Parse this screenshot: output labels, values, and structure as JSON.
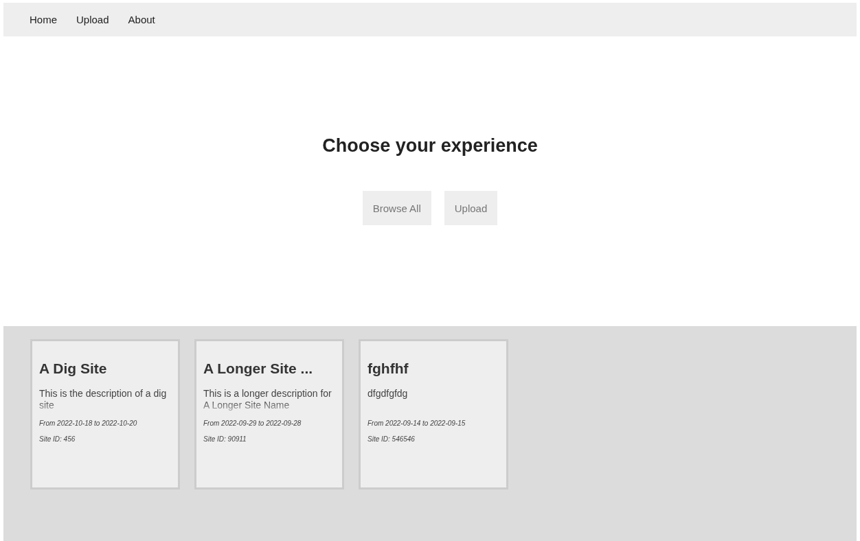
{
  "nav": {
    "links": [
      "Home",
      "Upload",
      "About"
    ]
  },
  "hero": {
    "title": "Choose your experience",
    "buttons": [
      "Browse All",
      "Upload"
    ]
  },
  "sites": [
    {
      "name": "A Dig Site",
      "description": "This is the description of a dig site",
      "dates": "From 2022-10-18 to 2022-10-20",
      "site_id": "Site ID: 456"
    },
    {
      "name": "A Longer Site ...",
      "description": "This is a longer description for A Longer Site Name",
      "dates": "From 2022-09-29 to 2022-09-28",
      "site_id": "Site ID: 90911"
    },
    {
      "name": "fghfhf",
      "description": "dfgdfgfdg",
      "dates": "From 2022-09-14 to 2022-09-15",
      "site_id": "Site ID: 546546"
    }
  ]
}
